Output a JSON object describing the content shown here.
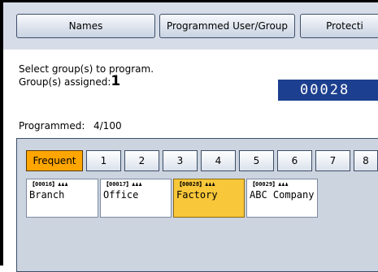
{
  "tabs": [
    "Names",
    "Programmed User/Group",
    "Protecti"
  ],
  "instruction": "Select group(s) to program.",
  "assigned_label": "Group(s) assigned:",
  "assigned_count": "1",
  "selected_number": "00028",
  "programmed_label": "Programmed:",
  "programmed_value": "4/100",
  "index_tabs": [
    "Frequent",
    "1",
    "2",
    "3",
    "4",
    "5",
    "6",
    "7",
    "8"
  ],
  "entries": [
    {
      "id": "【00016】",
      "name": "Branch"
    },
    {
      "id": "【00017】",
      "name": "Office"
    },
    {
      "id": "【00028】",
      "name": "Factory"
    },
    {
      "id": "【00029】",
      "name": "ABC Company"
    }
  ]
}
